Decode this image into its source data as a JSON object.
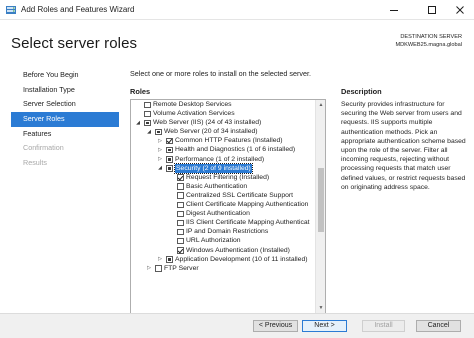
{
  "window": {
    "title": "Add Roles and Features Wizard",
    "icons": {
      "app": "server-manager-icon",
      "minimize": "minimize-icon",
      "maximize": "maximize-icon",
      "close": "close-icon"
    }
  },
  "header": {
    "title": "Select server roles",
    "destination_label": "DESTINATION SERVER",
    "destination_server": "MDKWEB25.magna.global"
  },
  "nav": {
    "items": [
      {
        "label": "Before You Begin",
        "state": "normal"
      },
      {
        "label": "Installation Type",
        "state": "normal"
      },
      {
        "label": "Server Selection",
        "state": "normal"
      },
      {
        "label": "Server Roles",
        "state": "active"
      },
      {
        "label": "Features",
        "state": "normal"
      },
      {
        "label": "Confirmation",
        "state": "disabled"
      },
      {
        "label": "Results",
        "state": "disabled"
      }
    ]
  },
  "main": {
    "intro": "Select one or more roles to install on the selected server.",
    "roles_heading": "Roles",
    "description_heading": "Description",
    "description": "Security provides infrastructure for securing the Web server from users and requests. IIS supports multiple authentication methods. Pick an appropriate authentication scheme based upon the role of the server. Filter all incoming requests, rejecting without processing requests that match user defined values, or restrict requests based on originating address space."
  },
  "roles_tree": [
    {
      "label": "Remote Desktop Services",
      "level": 0,
      "expander": "",
      "check": "none",
      "selected": false
    },
    {
      "label": "Volume Activation Services",
      "level": 0,
      "expander": "",
      "check": "none",
      "selected": false
    },
    {
      "label": "Web Server (IIS) (24 of 43 installed)",
      "level": 0,
      "expander": "collapse",
      "check": "partial",
      "selected": false
    },
    {
      "label": "Web Server (20 of 34 installed)",
      "level": 1,
      "expander": "collapse",
      "check": "partial",
      "selected": false
    },
    {
      "label": "Common HTTP Features (Installed)",
      "level": 2,
      "expander": "expand",
      "check": "checked",
      "selected": false
    },
    {
      "label": "Health and Diagnostics (1 of 6 installed)",
      "level": 2,
      "expander": "expand",
      "check": "partial",
      "selected": false
    },
    {
      "label": "Performance (1 of 2 installed)",
      "level": 2,
      "expander": "expand",
      "check": "partial",
      "selected": false
    },
    {
      "label": "Security (2 of 9 installed)",
      "level": 2,
      "expander": "collapse",
      "check": "partial",
      "selected": true
    },
    {
      "label": "Request Filtering (Installed)",
      "level": 3,
      "expander": "",
      "check": "checked",
      "selected": false
    },
    {
      "label": "Basic Authentication",
      "level": 3,
      "expander": "",
      "check": "none",
      "selected": false
    },
    {
      "label": "Centralized SSL Certificate Support",
      "level": 3,
      "expander": "",
      "check": "none",
      "selected": false
    },
    {
      "label": "Client Certificate Mapping Authentication",
      "level": 3,
      "expander": "",
      "check": "none",
      "selected": false
    },
    {
      "label": "Digest Authentication",
      "level": 3,
      "expander": "",
      "check": "none",
      "selected": false
    },
    {
      "label": "IIS Client Certificate Mapping Authenticat",
      "level": 3,
      "expander": "",
      "check": "none",
      "selected": false
    },
    {
      "label": "IP and Domain Restrictions",
      "level": 3,
      "expander": "",
      "check": "none",
      "selected": false
    },
    {
      "label": "URL Authorization",
      "level": 3,
      "expander": "",
      "check": "none",
      "selected": false
    },
    {
      "label": "Windows Authentication (Installed)",
      "level": 3,
      "expander": "",
      "check": "checked",
      "selected": false
    },
    {
      "label": "Application Development (10 of 11 installed)",
      "level": 2,
      "expander": "expand",
      "check": "partial",
      "selected": false
    },
    {
      "label": "FTP Server",
      "level": 1,
      "expander": "expand",
      "check": "none",
      "selected": false
    }
  ],
  "buttons": {
    "previous": "< Previous",
    "next": "Next >",
    "install": "Install",
    "cancel": "Cancel"
  },
  "colors": {
    "accent": "#2b7bd4",
    "selected_text": "#ffffff",
    "disabled_text": "#a8a8a8"
  }
}
